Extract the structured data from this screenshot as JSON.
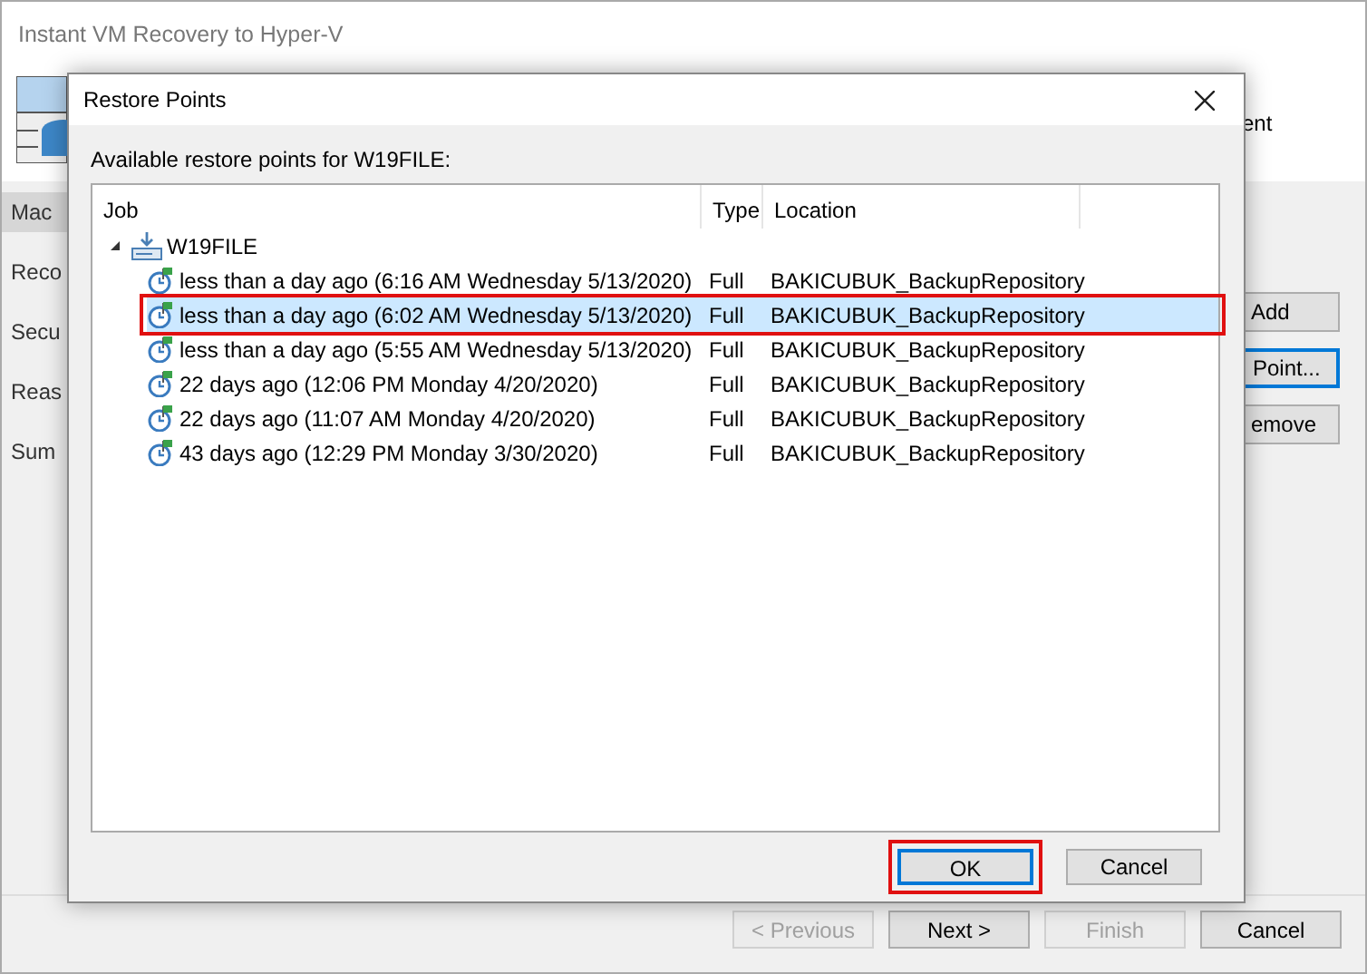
{
  "window": {
    "title": "Instant VM Recovery to Hyper-V"
  },
  "header_fragment": "ent",
  "steps": [
    {
      "label": "Mac",
      "selected": true
    },
    {
      "label": "Reco",
      "selected": false
    },
    {
      "label": "Secu",
      "selected": false
    },
    {
      "label": "Reas",
      "selected": false
    },
    {
      "label": "Sum",
      "selected": false
    }
  ],
  "side_buttons": [
    {
      "label": "Add",
      "focused": false
    },
    {
      "label": "Point...",
      "focused": true
    },
    {
      "label": "emove",
      "focused": false
    }
  ],
  "wizard_buttons": [
    {
      "label": "< Previous",
      "disabled": true
    },
    {
      "label": "Next >",
      "disabled": false
    },
    {
      "label": "Finish",
      "disabled": true
    },
    {
      "label": "Cancel",
      "disabled": false
    }
  ],
  "dialog": {
    "title": "Restore Points",
    "prompt": "Available restore points for W19FILE:",
    "columns": [
      "Job",
      "Type",
      "Location"
    ],
    "tree": {
      "name": "W19FILE",
      "expanded": true,
      "children": [
        {
          "job": "less than a day ago (6:16 AM Wednesday 5/13/2020)",
          "type": "Full",
          "location": "BAKICUBUK_BackupRepository",
          "selected": false,
          "highlighted": false
        },
        {
          "job": "less than a day ago (6:02 AM Wednesday 5/13/2020)",
          "type": "Full",
          "location": "BAKICUBUK_BackupRepository",
          "selected": true,
          "highlighted": true
        },
        {
          "job": "less than a day ago (5:55 AM Wednesday 5/13/2020)",
          "type": "Full",
          "location": "BAKICUBUK_BackupRepository",
          "selected": false,
          "highlighted": false
        },
        {
          "job": "22 days ago (12:06 PM Monday 4/20/2020)",
          "type": "Full",
          "location": "BAKICUBUK_BackupRepository",
          "selected": false,
          "highlighted": false
        },
        {
          "job": "22 days ago (11:07 AM Monday 4/20/2020)",
          "type": "Full",
          "location": "BAKICUBUK_BackupRepository",
          "selected": false,
          "highlighted": false
        },
        {
          "job": "43 days ago (12:29 PM Monday 3/30/2020)",
          "type": "Full",
          "location": "BAKICUBUK_BackupRepository",
          "selected": false,
          "highlighted": false
        }
      ]
    },
    "buttons": [
      {
        "label": "OK",
        "default": true,
        "highlighted": true
      },
      {
        "label": "Cancel",
        "default": false,
        "highlighted": false
      }
    ]
  }
}
